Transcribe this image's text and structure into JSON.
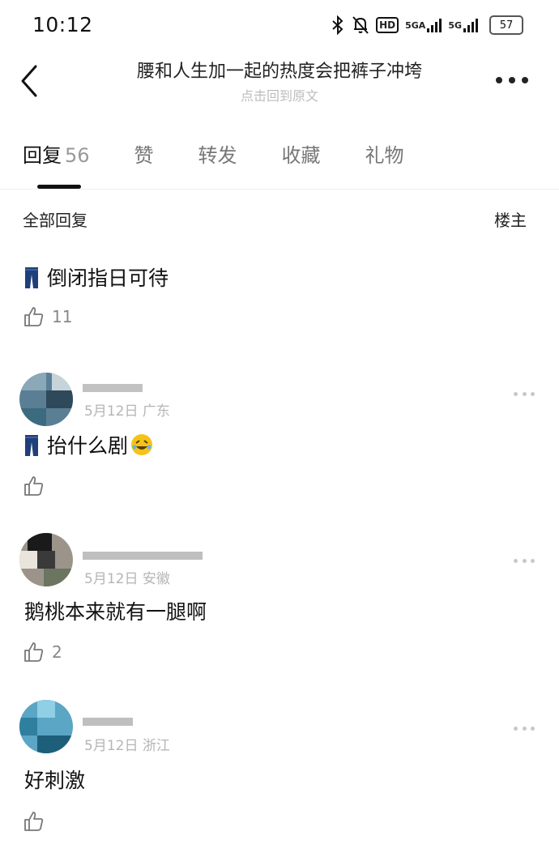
{
  "status_bar": {
    "time": "10:12",
    "hd": "HD",
    "network1": "5GA",
    "network2": "5G",
    "battery": "57"
  },
  "header": {
    "title": "腰和人生加一起的热度会把裤子冲垮",
    "subtitle": "点击回到原文",
    "more_icon": "more-horizontal-icon",
    "back_icon": "chevron-left-icon"
  },
  "tabs": [
    {
      "label": "回复",
      "count": "56"
    },
    {
      "label": "赞"
    },
    {
      "label": "转发"
    },
    {
      "label": "收藏"
    },
    {
      "label": "礼物"
    }
  ],
  "filter": {
    "label": "全部回复",
    "op_label": "楼主"
  },
  "comments": [
    {
      "text": "倒闭指日可待",
      "likes": "11"
    },
    {
      "date": "5月12日",
      "location": "广东",
      "text": "抬什么剧",
      "likes": ""
    },
    {
      "date": "5月12日",
      "location": "安徽",
      "text": "鹅桃本来就有一腿啊",
      "likes": "2"
    },
    {
      "date": "5月12日",
      "location": "浙江",
      "text": "好刺激",
      "likes": ""
    }
  ],
  "colors": {
    "text": "#111111",
    "muted": "#b5b5b5",
    "jeans": "#1f3f7a"
  }
}
